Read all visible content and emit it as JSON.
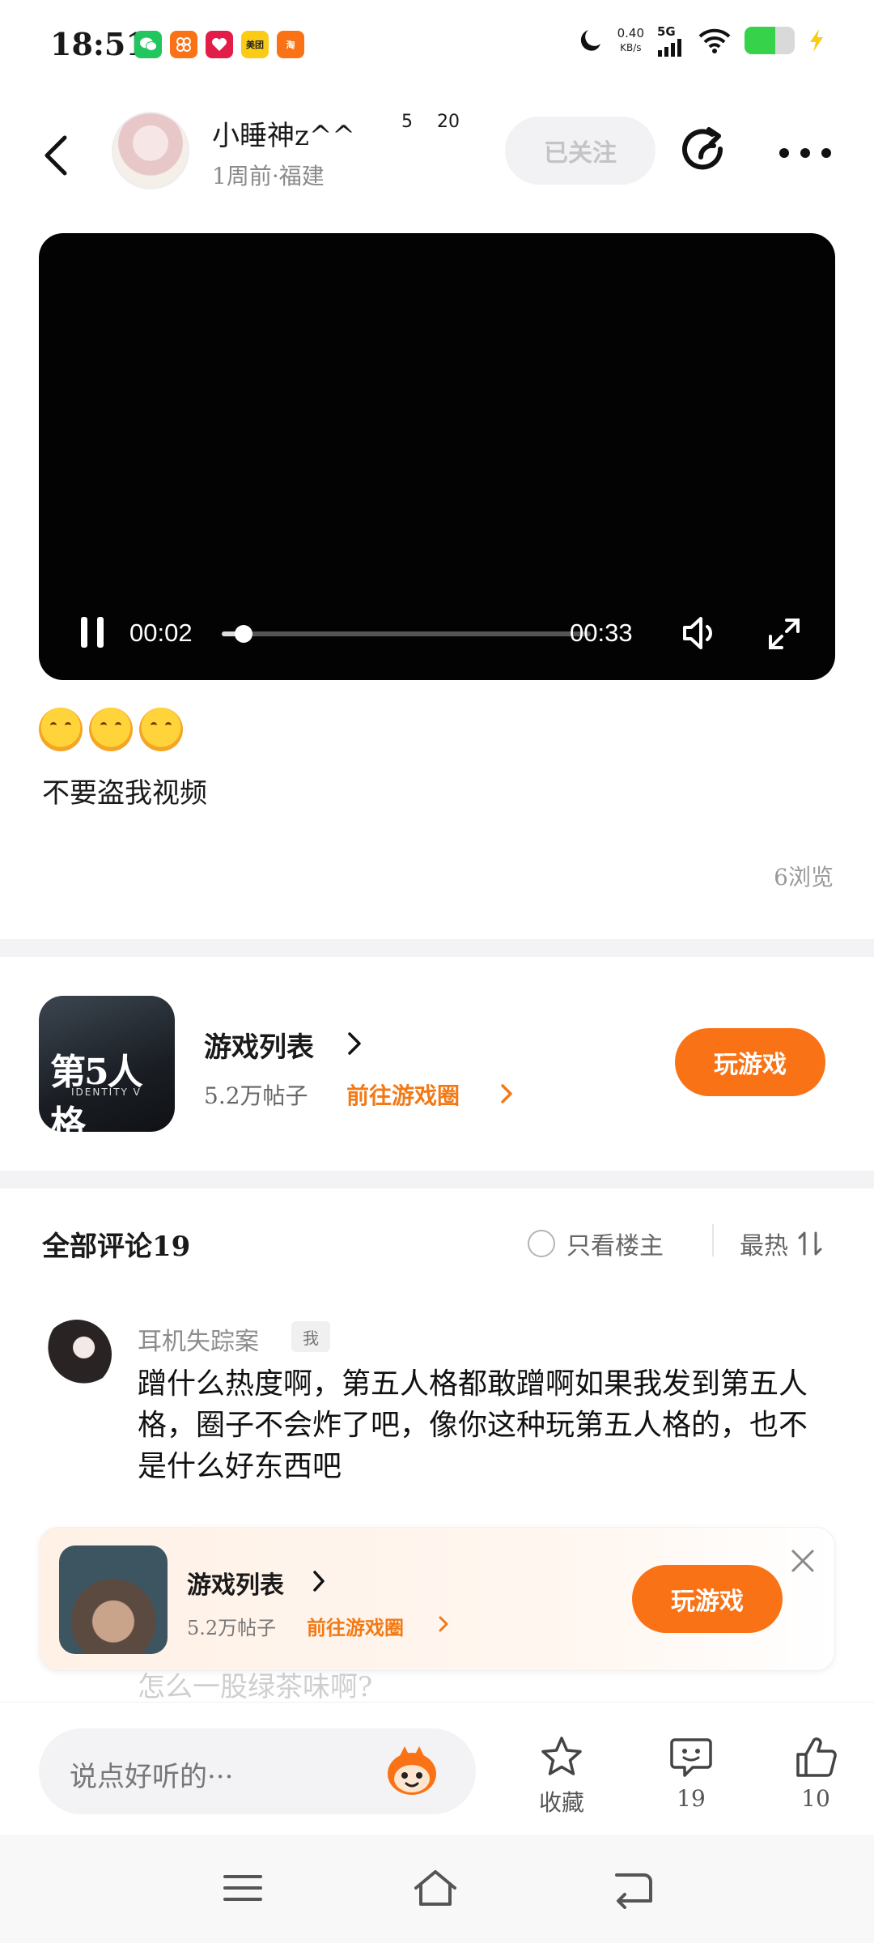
{
  "status_bar": {
    "time": "18:51",
    "apps": [
      {
        "name": "wechat-icon",
        "color": "#22c55e"
      },
      {
        "name": "app-orange-icon",
        "color": "#f97316"
      },
      {
        "name": "app-red-icon",
        "color": "#e11d48"
      },
      {
        "name": "meituan-icon",
        "color": "#facc15",
        "label": "美团"
      },
      {
        "name": "taobao-icon",
        "color": "#f97316",
        "label": "淘"
      }
    ],
    "net_speed_value": "0.40",
    "net_speed_unit": "KB/s",
    "network": "5G",
    "battery_level": 0.62
  },
  "header": {
    "username": "小睡神z^^",
    "badge_level_1": "5",
    "badge_level_2": "20",
    "meta": "1周前·福建",
    "follow_label": "已关注"
  },
  "video": {
    "current_time": "00:02",
    "total_time": "00:33",
    "progress": 0.06
  },
  "post": {
    "text": "不要盗我视频",
    "views": "6浏览"
  },
  "game_card": {
    "icon_text": "第5人格",
    "icon_subtext": "IDENTITY V",
    "title": "游戏列表",
    "posts": "5.2万帖子",
    "goto": "前往游戏圈",
    "play_label": "玩游戏"
  },
  "comments": {
    "title": "全部评论19",
    "only_op": "只看楼主",
    "sort": "最热"
  },
  "comment": {
    "author": "耳机失踪案",
    "me_tag": "我",
    "text": "蹭什么热度啊，第五人格都敢蹭啊如果我发到第五人格，圈子不会炸了吧，像你这种玩第五人格的，也不是什么好东西吧"
  },
  "faded": {
    "line2": "怎么一股绿茶味啊?"
  },
  "banner": {
    "title": "游戏列表",
    "posts": "5.2万帖子",
    "goto": "前往游戏圈",
    "play_label": "玩游戏"
  },
  "bottom_bar": {
    "input_placeholder": "说点好听的···",
    "collect_label": "收藏",
    "comment_count": "19",
    "like_count": "10"
  },
  "colors": {
    "accent": "#f97316",
    "link_orange": "#f27a16"
  }
}
